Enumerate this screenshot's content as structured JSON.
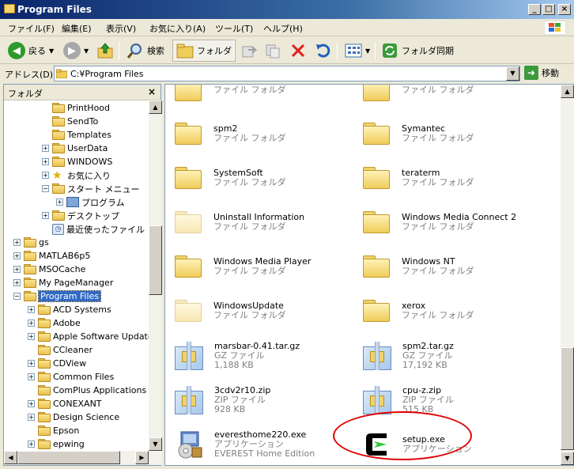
{
  "window": {
    "title": "Program Files"
  },
  "menu": [
    "ファイル(F)",
    "編集(E)",
    "表示(V)",
    "お気に入り(A)",
    "ツール(T)",
    "ヘルプ(H)"
  ],
  "toolbar": {
    "back": "戻る",
    "search": "検索",
    "folders": "フォルダ",
    "sync": "フォルダ同期"
  },
  "address": {
    "label": "アドレス(D)",
    "path": "C:¥Program Files",
    "go": "移動"
  },
  "pane": {
    "title": "フォルダ",
    "close": "×"
  },
  "tree": [
    {
      "label": "PrintHood",
      "level": 3,
      "toggle": ""
    },
    {
      "label": "SendTo",
      "level": 3,
      "toggle": ""
    },
    {
      "label": "Templates",
      "level": 3,
      "toggle": ""
    },
    {
      "label": "UserData",
      "level": 3,
      "toggle": "+"
    },
    {
      "label": "WINDOWS",
      "level": 3,
      "toggle": "+"
    },
    {
      "label": "お気に入り",
      "level": 3,
      "toggle": "+",
      "icon": "star"
    },
    {
      "label": "スタート メニュー",
      "level": 3,
      "toggle": "−"
    },
    {
      "label": "プログラム",
      "level": 4,
      "toggle": "+",
      "icon": "programs"
    },
    {
      "label": "デスクトップ",
      "level": 3,
      "toggle": "+"
    },
    {
      "label": "最近使ったファイル",
      "level": 3,
      "toggle": "",
      "icon": "recent"
    },
    {
      "label": "gs",
      "level": 1,
      "toggle": "+"
    },
    {
      "label": "MATLAB6p5",
      "level": 1,
      "toggle": "+"
    },
    {
      "label": "MSOCache",
      "level": 1,
      "toggle": "+"
    },
    {
      "label": "My PageManager",
      "level": 1,
      "toggle": "+"
    },
    {
      "label": "Program Files",
      "level": 1,
      "toggle": "−",
      "selected": true
    },
    {
      "label": "ACD Systems",
      "level": 2,
      "toggle": "+"
    },
    {
      "label": "Adobe",
      "level": 2,
      "toggle": "+"
    },
    {
      "label": "Apple Software Update",
      "level": 2,
      "toggle": "+"
    },
    {
      "label": "CCleaner",
      "level": 2,
      "toggle": ""
    },
    {
      "label": "CDView",
      "level": 2,
      "toggle": "+"
    },
    {
      "label": "Common Files",
      "level": 2,
      "toggle": "+"
    },
    {
      "label": "ComPlus Applications",
      "level": 2,
      "toggle": ""
    },
    {
      "label": "CONEXANT",
      "level": 2,
      "toggle": "+"
    },
    {
      "label": "Design Science",
      "level": 2,
      "toggle": "+"
    },
    {
      "label": "Epson",
      "level": 2,
      "toggle": ""
    },
    {
      "label": "epwing",
      "level": 2,
      "toggle": "+"
    }
  ],
  "items": [
    {
      "name": "",
      "type": "ファイル フォルダ",
      "kind": "folder"
    },
    {
      "name": "",
      "type": "ファイル フォルダ",
      "kind": "folder"
    },
    {
      "name": "spm2",
      "type": "ファイル フォルダ",
      "kind": "folder"
    },
    {
      "name": "Symantec",
      "type": "ファイル フォルダ",
      "kind": "folder"
    },
    {
      "name": "SystemSoft",
      "type": "ファイル フォルダ",
      "kind": "folder"
    },
    {
      "name": "teraterm",
      "type": "ファイル フォルダ",
      "kind": "folder"
    },
    {
      "name": "Uninstall Information",
      "type": "ファイル フォルダ",
      "kind": "ghost"
    },
    {
      "name": "Windows Media Connect 2",
      "type": "ファイル フォルダ",
      "kind": "folder"
    },
    {
      "name": "Windows Media Player",
      "type": "ファイル フォルダ",
      "kind": "folder"
    },
    {
      "name": "Windows NT",
      "type": "ファイル フォルダ",
      "kind": "folder"
    },
    {
      "name": "WindowsUpdate",
      "type": "ファイル フォルダ",
      "kind": "ghost"
    },
    {
      "name": "xerox",
      "type": "ファイル フォルダ",
      "kind": "folder"
    },
    {
      "name": "marsbar-0.41.tar.gz",
      "type": "GZ ファイル",
      "size": "1,188 KB",
      "kind": "zip"
    },
    {
      "name": "spm2.tar.gz",
      "type": "GZ ファイル",
      "size": "17,192 KB",
      "kind": "zip"
    },
    {
      "name": "3cdv2r10.zip",
      "type": "ZIP ファイル",
      "size": "928 KB",
      "kind": "zip"
    },
    {
      "name": "cpu-z.zip",
      "type": "ZIP ファイル",
      "size": "515 KB",
      "kind": "zip"
    },
    {
      "name": "everesthome220.exe",
      "type": "アプリケーション",
      "size": "EVEREST Home Edition",
      "kind": "installer"
    },
    {
      "name": "setup.exe",
      "type": "アプリケーション",
      "kind": "setup"
    }
  ]
}
